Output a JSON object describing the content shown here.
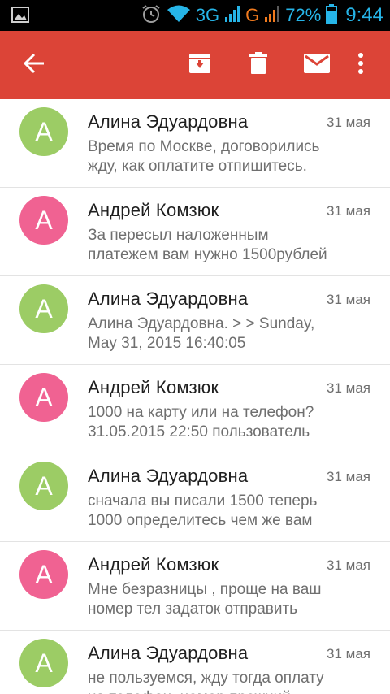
{
  "status_bar": {
    "network_3g": "3G",
    "network_g": "G",
    "battery": "72%",
    "time": "9:44",
    "icons": [
      "image-icon",
      "alarm-icon",
      "wifi-icon",
      "signal-icon",
      "battery-icon"
    ]
  },
  "toolbar": {
    "icons": [
      "back-arrow-icon",
      "archive-icon",
      "delete-icon",
      "mark-unread-icon",
      "more-vert-icon"
    ],
    "accent_color": "#dc4437"
  },
  "messages": [
    {
      "avatar_letter": "А",
      "avatar_color": "#9ccc65",
      "sender": "Алина Эдуардовна",
      "date": "31 мая",
      "snippet": "Время по Москве, договорились\nжду, как оплатите отпишитесь."
    },
    {
      "avatar_letter": "А",
      "avatar_color": "#f06292",
      "sender": "Андрей Комзюк",
      "date": "31 мая",
      "snippet": "За пересыл наложенным\nплатежем вам нужно 1500рублей"
    },
    {
      "avatar_letter": "А",
      "avatar_color": "#9ccc65",
      "sender": "Алина Эдуардовна",
      "date": "31 мая",
      "snippet": "Алина Эдуардовна. > > Sunday,\nMay 31, 2015 16:40:05"
    },
    {
      "avatar_letter": "А",
      "avatar_color": "#f06292",
      "sender": "Андрей Комзюк",
      "date": "31 мая",
      "snippet": "1000 на карту или на телефон?\n31.05.2015 22:50 пользователь"
    },
    {
      "avatar_letter": "А",
      "avatar_color": "#9ccc65",
      "sender": "Алина Эдуардовна",
      "date": "31 мая",
      "snippet": "сначала вы писали 1500 теперь\n1000 определитесь чем же вам"
    },
    {
      "avatar_letter": "А",
      "avatar_color": "#f06292",
      "sender": "Андрей Комзюк",
      "date": "31 мая",
      "snippet": "Мне безразницы , проще на ваш\nномер тел задаток отправить"
    },
    {
      "avatar_letter": "А",
      "avatar_color": "#9ccc65",
      "sender": "Алина Эдуардовна",
      "date": "31 мая",
      "snippet": "не пользуемся, жду тогда оплату\nна телефон, номер прежний"
    }
  ]
}
